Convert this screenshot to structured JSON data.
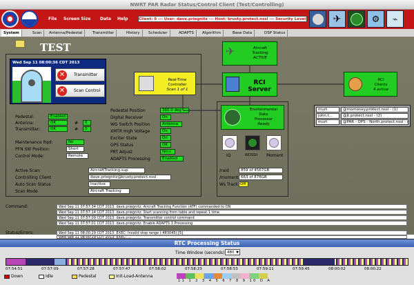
{
  "window": {
    "title": "NWRT PAR Radar Status/Control Client (Test/Controlling)"
  },
  "menu": [
    "File",
    "Screen Size",
    "Data",
    "Help"
  ],
  "client_info": "Client: 0 --- User: dave.priegnitz --- Host: krusty.protect.nssl --- Security Level: 1",
  "tabs": [
    "System",
    "Scan",
    "Antenna/Pedestal",
    "Transmitter",
    "History",
    "Scheduler",
    "ADAPTS",
    "Algorithm",
    "Base Data",
    "DSP Status"
  ],
  "mode_title": "TEST",
  "clock": "Wed Sep 11 08:00:36 CDT 2013",
  "buttons": {
    "transmitter": "Transmitter",
    "scan_control": "Scan Control"
  },
  "status_left": {
    "pedestal_label": "Pedestal:",
    "pedestal": "Enabled",
    "antenna_label": "Antenna:",
    "antenna": "OK",
    "antenna_num": "0",
    "transmitter_label": "Transmitter:",
    "transmitter": "OK",
    "transmitter_num": "0",
    "hash": "#",
    "maint_label": "Maintenance Rqd:",
    "maint": "No",
    "pfn_label": "PFN SW Position:",
    "pfn": "Short",
    "control_label": "Control Mode:",
    "control": "Remote"
  },
  "status_right": {
    "ped_pos_label": "Pedestal Position",
    "ped_pos": "360.0 deg",
    "digital_label": "Digital Receiver",
    "digital": "On",
    "wg_label": "WG Switch Position",
    "wg": "Antenna",
    "xmtr_label": "XMTR High Voltage",
    "xmtr": "On",
    "exciter_label": "Exciter State",
    "exciter": "On",
    "gps_label": "GPS Status",
    "gps": "OK",
    "prt_label": "PRT Adjust",
    "prt": "Nmu",
    "adapts_label": "ADAPTS Processing",
    "adapts": "Enabled"
  },
  "scan_info": {
    "active_label": "Active Scan:",
    "active": "AircraftTracking.sup",
    "client_label": "Controlling Client",
    "client": "dave.priegnitz@krusty.protect.nssl",
    "auto_label": "Auto Scan Status",
    "auto": "Inactive",
    "mode_label": "Scan Mode",
    "mode": "Aircraft Tracking"
  },
  "nodes": {
    "rtc": {
      "line1": "Real-Time",
      "line2": "Controller",
      "line3": "Scan 1 of 1"
    },
    "aircraft": {
      "line1": "Aircraft",
      "line2": "Tracking",
      "line3": "ACTIVE"
    },
    "rci_server": {
      "line1": "RCI",
      "line2": "Server"
    },
    "rci_clients": {
      "line1": "RCI",
      "line2": "Clients",
      "line3": "4 active"
    },
    "edp": {
      "line1": "Environmental",
      "line2": "Data",
      "line3": "Processor",
      "line4": "Ready"
    },
    "iq": "IQ",
    "wdssii": "WDSSII",
    "moment": "Moment"
  },
  "clients": [
    {
      "user": "murt",
      "host": "@momoney.protect.nssl - (1)"
    },
    {
      "user": "john.t...",
      "host": "@jt.protect.nssl - (2)"
    },
    {
      "user": "murt",
      "host": "@PAR - OPS - North.protect.nssl - (3)"
    }
  ],
  "storage": {
    "raid_label": "/raid",
    "raid": "859 of 4567GB",
    "moment_label": "/moment",
    "moment": "663 of 878GB",
    "ws_label": "Ws Track",
    "ws": "Off"
  },
  "command": {
    "label": "Command:",
    "lines": [
      "Wed Sep 11 07:57:34 CDT 2013: dave.priegnitz: Aircraft Tracking Function (ATF) commanded to ON",
      "Wed Sep 11 07:57:14 CDT 2013: dave.priegnitz: Start scanning from table and repeat 1 time",
      "Wed Sep 11 07:57:09 CDT 2013: dave.priegnitz: Transmitter control command",
      "Wed Sep 11 07:57:01 CDT 2013: dave.priegnitz: Enable ADAPTS 3 Processing"
    ]
  },
  "errors": {
    "label": "Status/Errors:",
    "lines": [
      "Wed Sep 11 08:00:29 CDT 2013: EXEC: Invalid stop range (-483045) [5]",
      "Wed Sep 11 08:00:29 CDT 2013: EXEC: ..."
    ]
  },
  "rtc_bar": {
    "title": "RTC Processing Status",
    "window_label": "Time Window (seconds):",
    "window_value": "480",
    "ticks": [
      "07:54:51",
      "07:57:09",
      "07:57:28",
      "07:57:47",
      "07:58:02",
      "07:58:23",
      "07:58:53",
      "07:59:11",
      "07:59:45",
      "08:00:02",
      "08:00:22"
    ],
    "legend": [
      "Down",
      "Idle",
      "Pedestal",
      "Init-Load-Antenna"
    ],
    "legend_colors": [
      "#cc0000",
      "#ffffff",
      "#ffdd44",
      "#ffff88"
    ],
    "numbers": [
      "11",
      "1",
      "2",
      "3",
      "4",
      "5",
      "6",
      "7",
      "8",
      "9",
      "10",
      "D",
      "A"
    ]
  }
}
